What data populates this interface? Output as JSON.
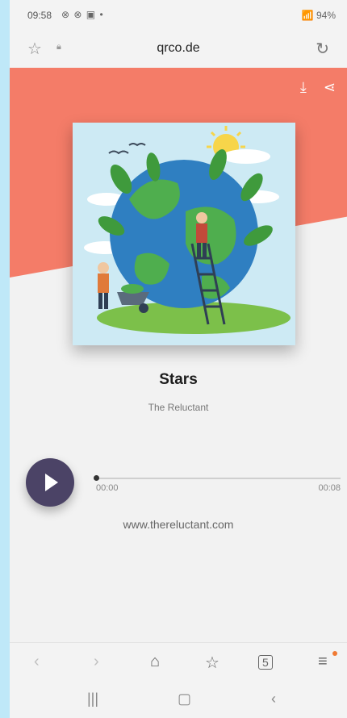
{
  "status_bar": {
    "time": "09:58",
    "left_icons": "⊗ ⊗ ▣ •",
    "right_text": "📶 94%"
  },
  "browser": {
    "url": "qrco.de",
    "icons": [
      "star-icon",
      "lock-icon",
      "reload-icon"
    ]
  },
  "page_actions": {
    "icons": [
      "download-icon",
      "share-icon"
    ]
  },
  "player": {
    "title": "Stars",
    "artist": "The Reluctant",
    "current_time": "00:00",
    "total_time": "00:08",
    "progress": 0,
    "link": "www.thereluctant.com"
  },
  "toolbar": {
    "items": [
      "back",
      "forward",
      "home",
      "bookmark",
      "tabs",
      "menu"
    ],
    "tabs_count": "5"
  },
  "colors": {
    "coral": "#f47c68",
    "play_button": "#4b4366",
    "menu_badge": "#f07a33"
  }
}
